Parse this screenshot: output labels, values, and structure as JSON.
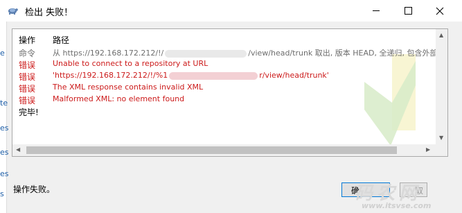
{
  "window": {
    "title": "检出 失败！"
  },
  "log": {
    "columns": {
      "op": "操作",
      "path": "路径"
    },
    "rows": [
      {
        "op": "命令",
        "path_before": "从 https://192.168.172.212/!/",
        "path_after": "/view/head/trunk 取出, 版本 HEAD, 全递归, 包含外部引用"
      },
      {
        "op": "错误",
        "path_before": "Unable to connect to a repository at URL",
        "path_after": ""
      },
      {
        "op": "错误",
        "path_before": " 'https://192.168.172.212/!/%1",
        "path_after": "r/view/head/trunk'"
      },
      {
        "op": "错误",
        "path_before": "The XML response contains invalid XML",
        "path_after": ""
      },
      {
        "op": "错误",
        "path_before": "Malformed XML: no element found",
        "path_after": ""
      },
      {
        "op": "完毕!",
        "path_before": "",
        "path_after": ""
      }
    ]
  },
  "status": {
    "text": "操作失败。"
  },
  "buttons": {
    "ok_label": "确",
    "disabled_label": "取"
  },
  "watermark": {
    "logo_text": "码农网",
    "url_text": "www.itsvse.com"
  },
  "colors": {
    "error": "#cc1a1a",
    "command": "#6d6d6d",
    "accent": "#0078d7"
  }
}
